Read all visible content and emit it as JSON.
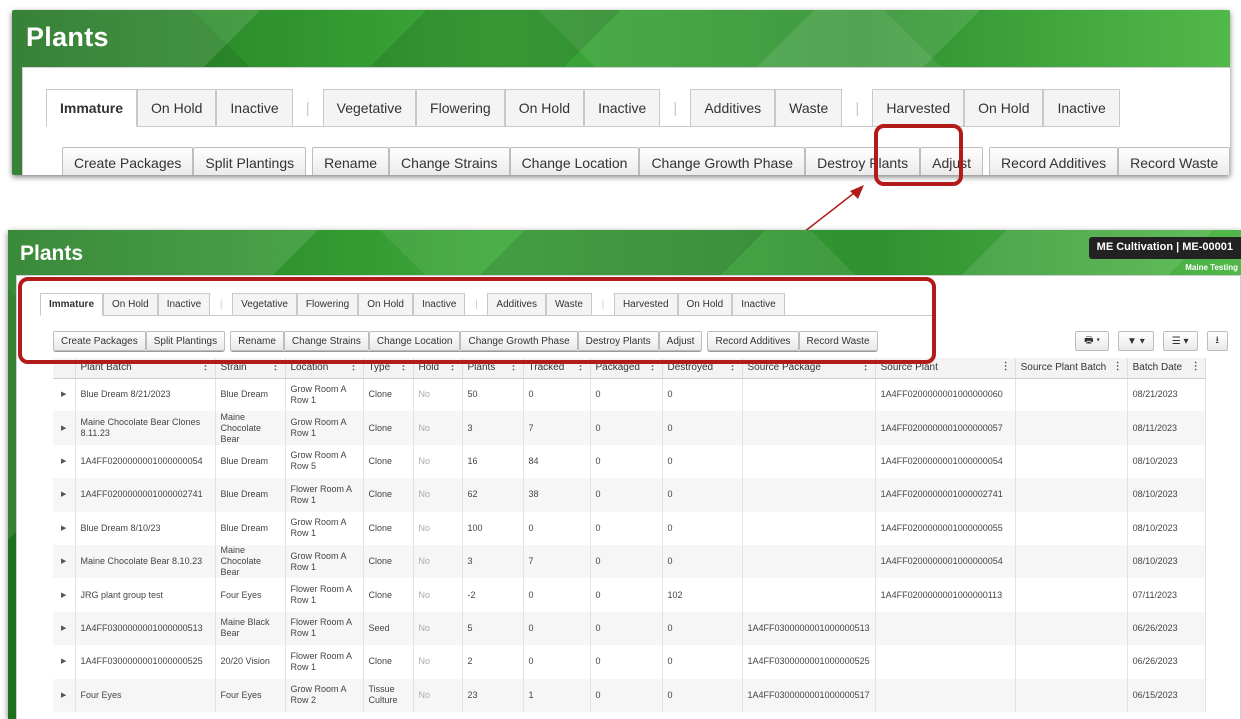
{
  "page_title": "Plants",
  "facility": {
    "label": "ME Cultivation | ME-00001",
    "sub": "Maine Testing"
  },
  "tabs": [
    {
      "label": "Immature",
      "active": true
    },
    {
      "label": "On Hold"
    },
    {
      "label": "Inactive"
    },
    {
      "sep": "|"
    },
    {
      "label": "Vegetative"
    },
    {
      "label": "Flowering"
    },
    {
      "label": "On Hold"
    },
    {
      "label": "Inactive"
    },
    {
      "sep": "|"
    },
    {
      "label": "Additives"
    },
    {
      "label": "Waste"
    },
    {
      "sep": "|"
    },
    {
      "label": "Harvested"
    },
    {
      "label": "On Hold"
    },
    {
      "label": "Inactive"
    }
  ],
  "action_groups": [
    [
      "Create Packages",
      "Split Plantings"
    ],
    [
      "Rename",
      "Change Strains",
      "Change Location",
      "Change Growth Phase",
      "Destroy Plants",
      "Adjust"
    ],
    [
      "Record Additives",
      "Record Waste"
    ]
  ],
  "tools": [
    {
      "icon": "print-icon",
      "glyph": "🖶 ▾"
    },
    {
      "icon": "filter-icon",
      "glyph": "▼ ▾"
    },
    {
      "icon": "columns-menu-icon",
      "glyph": "☰ ▾"
    },
    {
      "icon": "download-icon",
      "glyph": "⭳"
    }
  ],
  "columns": [
    "",
    "Plant Batch",
    "Strain",
    "Location",
    "Type",
    "Hold",
    "Plants",
    "Tracked",
    "Packaged",
    "Destroyed",
    "Source Package",
    "Source Plant",
    "Source Plant Batch",
    "Batch Date"
  ],
  "rows": [
    [
      "Blue Dream 8/21/2023",
      "Blue Dream",
      "Grow Room A Row 1",
      "Clone",
      "No",
      "50",
      "0",
      "0",
      "0",
      "",
      "1A4FF0200000001000000060",
      "",
      "08/21/2023"
    ],
    [
      "Maine Chocolate Bear Clones 8.11.23",
      "Maine Chocolate Bear",
      "Grow Room A Row 1",
      "Clone",
      "No",
      "3",
      "7",
      "0",
      "0",
      "",
      "1A4FF0200000001000000057",
      "",
      "08/11/2023"
    ],
    [
      "1A4FF0200000001000000054",
      "Blue Dream",
      "Grow Room A Row 5",
      "Clone",
      "No",
      "16",
      "84",
      "0",
      "0",
      "",
      "1A4FF0200000001000000054",
      "",
      "08/10/2023"
    ],
    [
      "1A4FF0200000001000002741",
      "Blue Dream",
      "Flower Room A Row 1",
      "Clone",
      "No",
      "62",
      "38",
      "0",
      "0",
      "",
      "1A4FF0200000001000002741",
      "",
      "08/10/2023"
    ],
    [
      "Blue Dream 8/10/23",
      "Blue Dream",
      "Grow Room A Row 1",
      "Clone",
      "No",
      "100",
      "0",
      "0",
      "0",
      "",
      "1A4FF0200000001000000055",
      "",
      "08/10/2023"
    ],
    [
      "Maine Chocolate Bear 8.10.23",
      "Maine Chocolate Bear",
      "Grow Room A Row 1",
      "Clone",
      "No",
      "3",
      "7",
      "0",
      "0",
      "",
      "1A4FF0200000001000000054",
      "",
      "08/10/2023"
    ],
    [
      "JRG plant group test",
      "Four Eyes",
      "Flower Room A Row 1",
      "Clone",
      "No",
      "-2",
      "0",
      "0",
      "102",
      "",
      "1A4FF0200000001000000113",
      "",
      "07/11/2023"
    ],
    [
      "1A4FF0300000001000000513",
      "Maine Black Bear",
      "Flower Room A Row 1",
      "Seed",
      "No",
      "5",
      "0",
      "0",
      "0",
      "1A4FF0300000001000000513",
      "",
      "",
      "06/26/2023"
    ],
    [
      "1A4FF0300000001000000525",
      "20/20 Vision",
      "Flower Room A Row 1",
      "Clone",
      "No",
      "2",
      "0",
      "0",
      "0",
      "1A4FF0300000001000000525",
      "",
      "",
      "06/26/2023"
    ],
    [
      "Four Eyes",
      "Four Eyes",
      "Grow Room A Row 2",
      "Tissue Culture",
      "No",
      "23",
      "1",
      "0",
      "0",
      "1A4FF0300000001000000517",
      "",
      "",
      "06/15/2023"
    ]
  ],
  "colors": {
    "highlight": "#b31b1b",
    "brand_green": "#2f9130"
  }
}
